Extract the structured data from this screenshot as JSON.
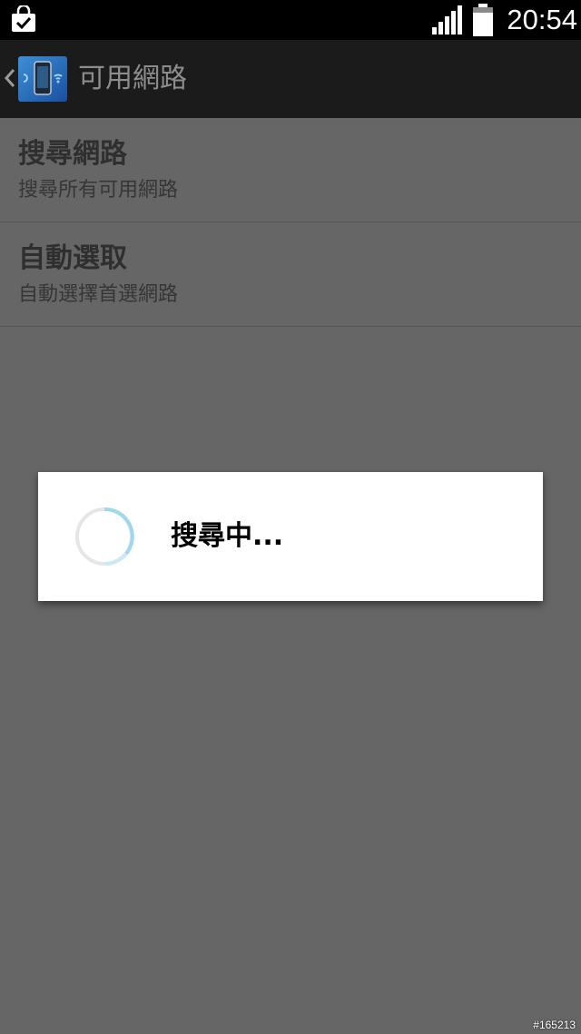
{
  "status_bar": {
    "time": "20:54",
    "icons": [
      "shopping-bag-check-icon",
      "signal-icon",
      "battery-icon"
    ]
  },
  "action_bar": {
    "title": "可用網路",
    "icons": [
      "back-chevron-icon",
      "app-icon"
    ]
  },
  "list": {
    "items": [
      {
        "title": "搜尋網路",
        "summary": "搜尋所有可用網路"
      },
      {
        "title": "自動選取",
        "summary": "自動選擇首選網路"
      }
    ]
  },
  "dialog": {
    "message": "搜尋中..."
  },
  "watermark": "#165213",
  "colors": {
    "status_bar": "#000000",
    "action_bar": "#1b1b1b",
    "dim_background": "#666666",
    "dialog_background": "#ffffff",
    "spinner_accent": "#9fd8ee"
  }
}
